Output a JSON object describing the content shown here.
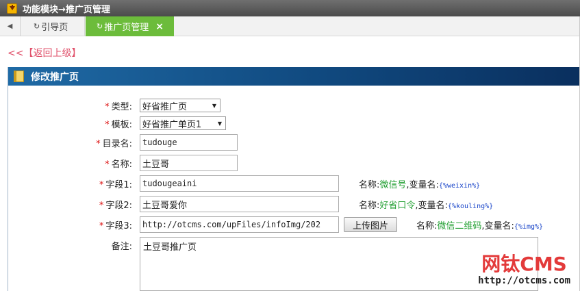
{
  "header": {
    "title": "功能模块→推广页管理"
  },
  "tabs": [
    {
      "label": "引导页",
      "icon": "refresh-icon"
    },
    {
      "label": "推广页管理",
      "icon": "refresh-icon",
      "close": "×"
    }
  ],
  "back_link": "<<【返回上级】",
  "panel": {
    "title": "修改推广页"
  },
  "form": {
    "required_mark": "*",
    "type": {
      "label": "类型:",
      "value": "好省推广页",
      "arrow": "▼"
    },
    "template": {
      "label": "模板:",
      "value": "好省推广单页1",
      "arrow": "▼"
    },
    "dir": {
      "label": "目录名:",
      "value": "tudouge"
    },
    "name": {
      "label": "名称:",
      "value": "土豆哥"
    },
    "field1": {
      "label": "字段1:",
      "value": "tudougeaini",
      "hint_prefix": "名称:",
      "hint_name": "微信号",
      "hint_mid": ",变量名:",
      "hint_var": "{%weixin%}"
    },
    "field2": {
      "label": "字段2:",
      "value": "土豆哥爱你",
      "hint_prefix": "名称:",
      "hint_name": "好省口令",
      "hint_mid": ",变量名:",
      "hint_var": "{%kouling%}"
    },
    "field3": {
      "label": "字段3:",
      "value": "http://otcms.com/upFiles/infoImg/202",
      "button": "上传图片",
      "hint_prefix": "名称:",
      "hint_name": "微信二维码",
      "hint_mid": ",变量名:",
      "hint_var": "{%img%}"
    },
    "note": {
      "label": "备注:",
      "value": "土豆哥推广页"
    }
  },
  "watermark": {
    "brand": "网钛CMS",
    "url": "http://otcms.com"
  },
  "colors": {
    "tab_active": "#6cbc3b",
    "panel_header": "#10497f",
    "required": "#dd1111",
    "hint_green": "#23a033",
    "hint_var": "#1844c9",
    "brand": "#e33a3a"
  }
}
